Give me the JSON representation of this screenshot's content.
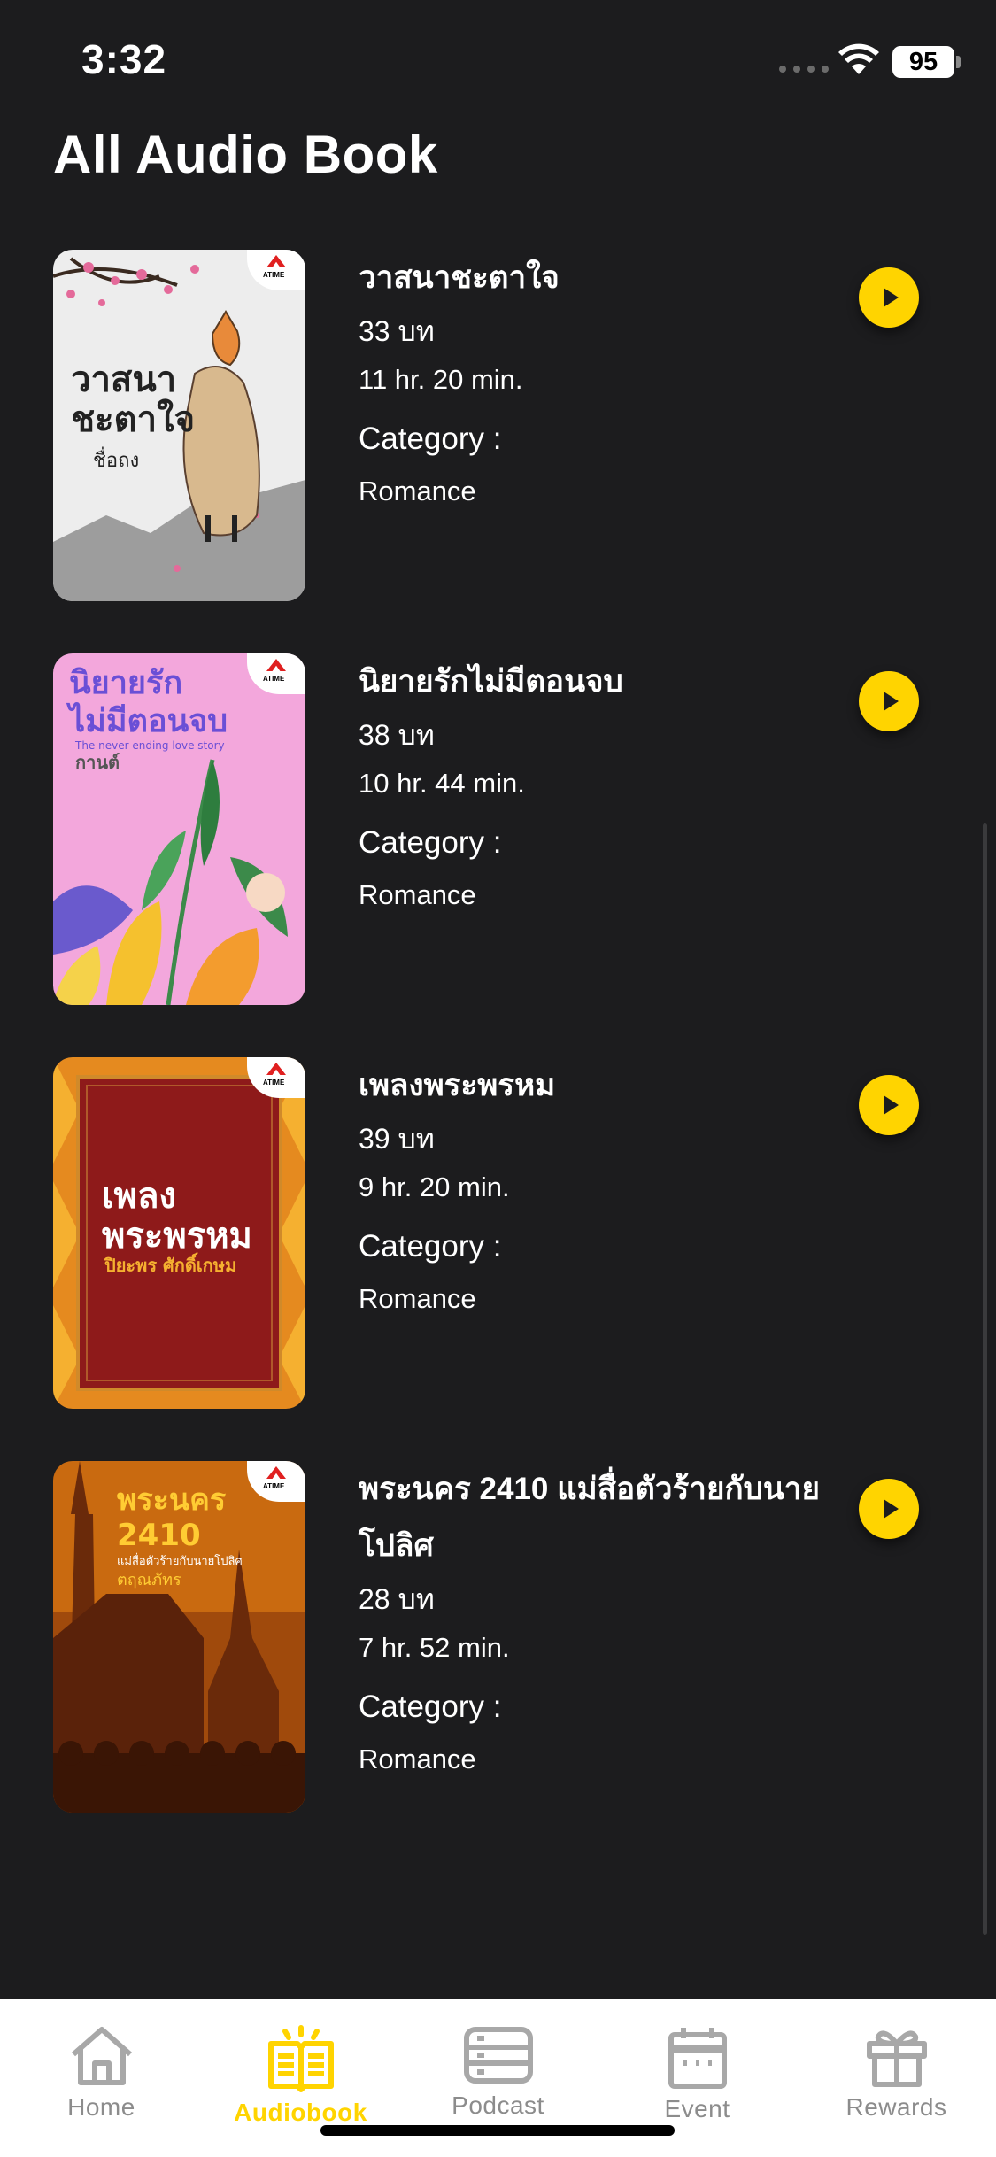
{
  "status": {
    "time": "3:32",
    "battery": "95"
  },
  "header": {
    "title": "All Audio Book"
  },
  "books": [
    {
      "title": "วาสนาชะตาใจ",
      "chapters": "33 บท",
      "duration": "11 hr. 20 min.",
      "category_label": "Category :",
      "category": "Romance",
      "cover_text": [
        "วาสนา",
        "ชะตาใจ",
        "ชื่อถง"
      ]
    },
    {
      "title": "นิยายรักไม่มีตอนจบ",
      "chapters": "38 บท",
      "duration": "10 hr. 44 min.",
      "category_label": "Category :",
      "category": "Romance",
      "cover_text": [
        "นิยายรัก",
        "ไม่มีตอนจบ",
        "The never ending love story",
        "กานต์"
      ]
    },
    {
      "title": "เพลงพระพรหม",
      "chapters": "39 บท",
      "duration": "9 hr. 20 min.",
      "category_label": "Category :",
      "category": "Romance",
      "cover_text": [
        "เพลง",
        "พระพรหม",
        "ปิยะพร ศักดิ์เกษม"
      ]
    },
    {
      "title": "พระนคร 2410 แม่สื่อตัวร้ายกับนายโปลิศ",
      "chapters": "28 บท",
      "duration": "7 hr. 52 min.",
      "category_label": "Category :",
      "category": "Romance",
      "cover_text": [
        "พระนคร",
        "2410",
        "แม่สื่อตัวร้ายกับนายโปลิศ",
        "ตฤณภัทร"
      ]
    }
  ],
  "cover_badge": "ATIME",
  "tabs": [
    {
      "label": "Home",
      "icon": "home-icon"
    },
    {
      "label": "Audiobook",
      "icon": "audiobook-icon"
    },
    {
      "label": "Podcast",
      "icon": "podcast-icon"
    },
    {
      "label": "Event",
      "icon": "event-icon"
    },
    {
      "label": "Rewards",
      "icon": "rewards-icon"
    }
  ],
  "colors": {
    "background": "#1c1c1e",
    "accent": "#ffd400",
    "tab_inactive": "#8c8c8c"
  }
}
